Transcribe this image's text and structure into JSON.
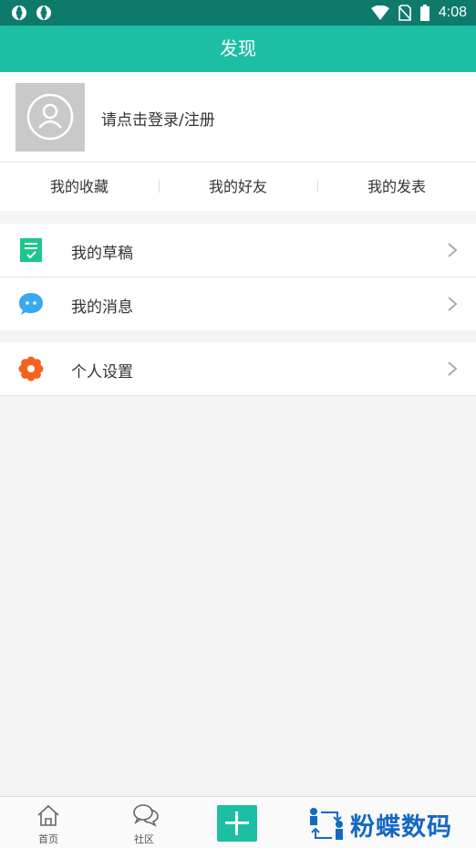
{
  "status_bar": {
    "time": "4:08"
  },
  "header": {
    "title": "发现"
  },
  "profile": {
    "login_prompt": "请点击登录/注册"
  },
  "quick_links": [
    {
      "label": "我的收藏"
    },
    {
      "label": "我的好友"
    },
    {
      "label": "我的发表"
    }
  ],
  "menu": [
    {
      "label": "我的草稿",
      "icon": "draft-icon",
      "color": "#1ec58f"
    },
    {
      "label": "我的消息",
      "icon": "message-icon",
      "color": "#3aa8f0"
    },
    {
      "label": "个人设置",
      "icon": "gear-icon",
      "color": "#f4621f"
    }
  ],
  "bottom_nav": {
    "home_label": "首页",
    "community_label": "社区",
    "watermark_text": "粉蝶数码"
  },
  "colors": {
    "accent": "#1cbfa3",
    "status": "#0e7a6c"
  }
}
